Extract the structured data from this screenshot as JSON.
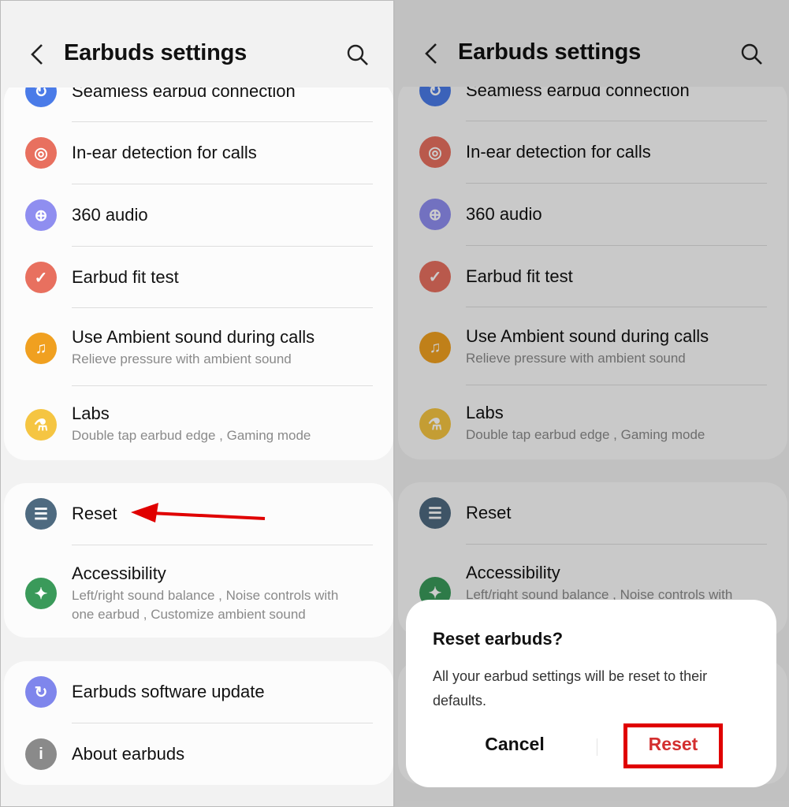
{
  "header": {
    "title": "Earbuds settings",
    "back_icon": "back-chevron-icon",
    "search_icon": "search-icon"
  },
  "groups": [
    {
      "items": [
        {
          "id": "seamless",
          "title": "Seamless earbud connection",
          "icon": "seamless-connection-icon",
          "color": "#4a7be8"
        },
        {
          "id": "in-ear",
          "title": "In-ear detection for calls",
          "icon": "ear-icon",
          "color": "#e8705f"
        },
        {
          "id": "360-audio",
          "title": "360 audio",
          "icon": "globe-icon",
          "color": "#8f8ef0"
        },
        {
          "id": "fit-test",
          "title": "Earbud fit test",
          "icon": "fit-test-icon",
          "color": "#e8705f"
        },
        {
          "id": "ambient",
          "title": "Use Ambient sound during calls",
          "subtitle": "Relieve pressure with ambient sound",
          "icon": "ambient-sound-icon",
          "color": "#f0a020"
        },
        {
          "id": "labs",
          "title": "Labs",
          "subtitle": "Double tap earbud edge , Gaming mode",
          "icon": "flask-icon",
          "color": "#f5c542"
        }
      ]
    },
    {
      "items": [
        {
          "id": "reset",
          "title": "Reset",
          "icon": "sliders-icon",
          "color": "#4e6a80"
        },
        {
          "id": "accessibility",
          "title": "Accessibility",
          "subtitle": "Left/right sound balance , Noise controls with one earbud , Customize ambient sound",
          "subtitle_lines": [
            "Left/right sound balance , Noise controls with",
            "one earbud , Customize ambient sound"
          ],
          "icon": "accessibility-icon",
          "color": "#3a9a5a"
        }
      ]
    },
    {
      "items": [
        {
          "id": "update",
          "title": "Earbuds software update",
          "icon": "update-icon",
          "color": "#7f86ec"
        },
        {
          "id": "about",
          "title": "About earbuds",
          "icon": "info-icon",
          "color": "#8a8a8a"
        }
      ]
    }
  ],
  "dialog": {
    "title": "Reset earbuds?",
    "body": "All your earbud settings will be reset to their defaults.",
    "cancel": "Cancel",
    "confirm": "Reset",
    "confirm_color": "#d32f2f",
    "highlight_color": "#e00000"
  },
  "annotation": {
    "arrow_color": "#e00000",
    "arrow_target": "Reset"
  }
}
